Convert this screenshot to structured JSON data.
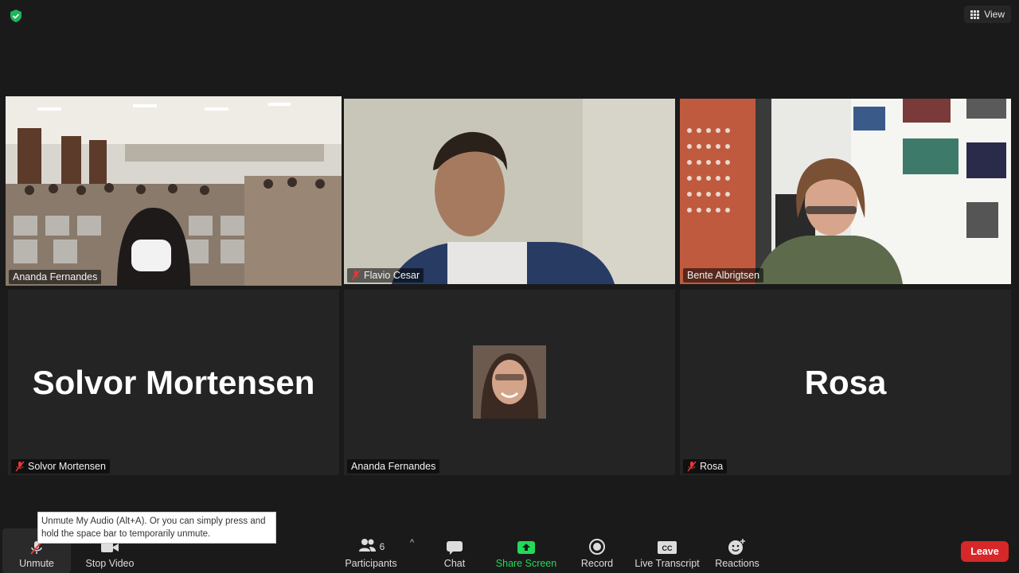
{
  "top": {
    "view_label": "View"
  },
  "tiles": [
    {
      "name": "Ananda Fernandes",
      "muted": false,
      "active": true
    },
    {
      "name": "Flavio Cesar",
      "muted": true
    },
    {
      "name": "Bente Albrigtsen",
      "muted": false
    },
    {
      "name": "Solvor Mortensen",
      "muted": true,
      "big_label": "Solvor Mortensen"
    },
    {
      "name": "Ananda Fernandes",
      "muted": false
    },
    {
      "name": "Rosa",
      "muted": true,
      "big_label": "Rosa"
    }
  ],
  "tooltip": {
    "text": "Unmute My Audio (Alt+A). Or you can simply press and hold the space bar to temporarily unmute."
  },
  "toolbar": {
    "unmute_label": "Unmute",
    "stop_video_label": "Stop Video",
    "participants_label": "Participants",
    "participants_count": "6",
    "chat_label": "Chat",
    "share_screen_label": "Share Screen",
    "record_label": "Record",
    "live_transcript_label": "Live Transcript",
    "reactions_label": "Reactions",
    "leave_label": "Leave"
  },
  "colors": {
    "accent_green": "#23d959",
    "leave_red": "#d62828",
    "active_border": "#e2e97a"
  }
}
